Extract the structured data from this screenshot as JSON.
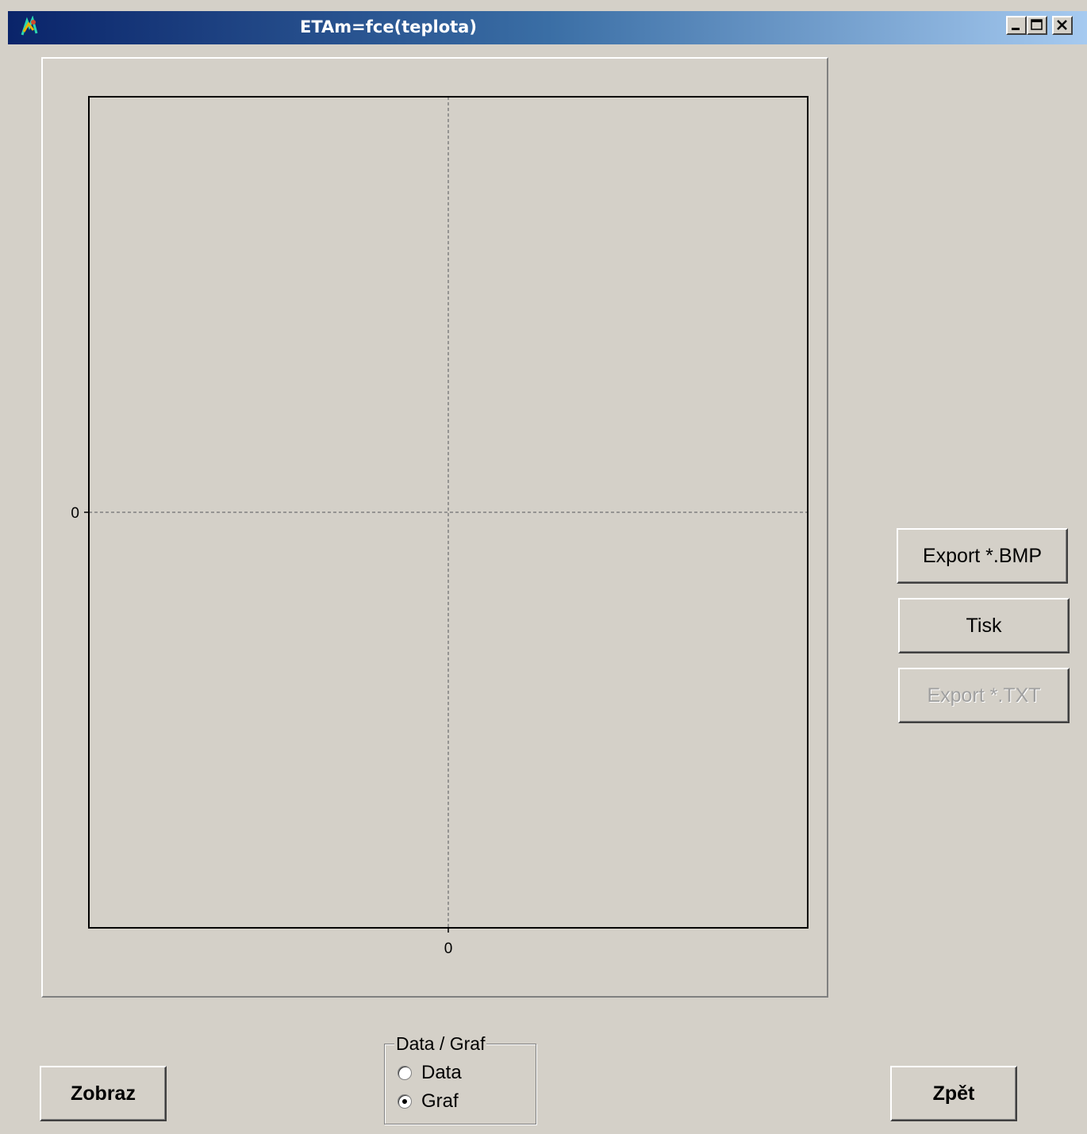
{
  "window": {
    "title": "ETAm=fce(teplota)",
    "icon": "app-icon",
    "controls": [
      "minimize-icon",
      "maximize-icon",
      "close-icon"
    ]
  },
  "chart_data": {
    "type": "line",
    "title": "",
    "xlabel": "",
    "ylabel": "",
    "x_ticks": [
      "0"
    ],
    "y_ticks": [
      "0"
    ],
    "series": [],
    "grid": true
  },
  "buttons": {
    "export_bmp": "Export *.BMP",
    "tisk": "Tisk",
    "export_txt": "Export *.TXT",
    "zobraz": "Zobraz",
    "zpet": "Zpět"
  },
  "mode_group": {
    "legend": "Data / Graf",
    "options": [
      {
        "label": "Data",
        "checked": false
      },
      {
        "label": "Graf",
        "checked": true
      }
    ]
  }
}
